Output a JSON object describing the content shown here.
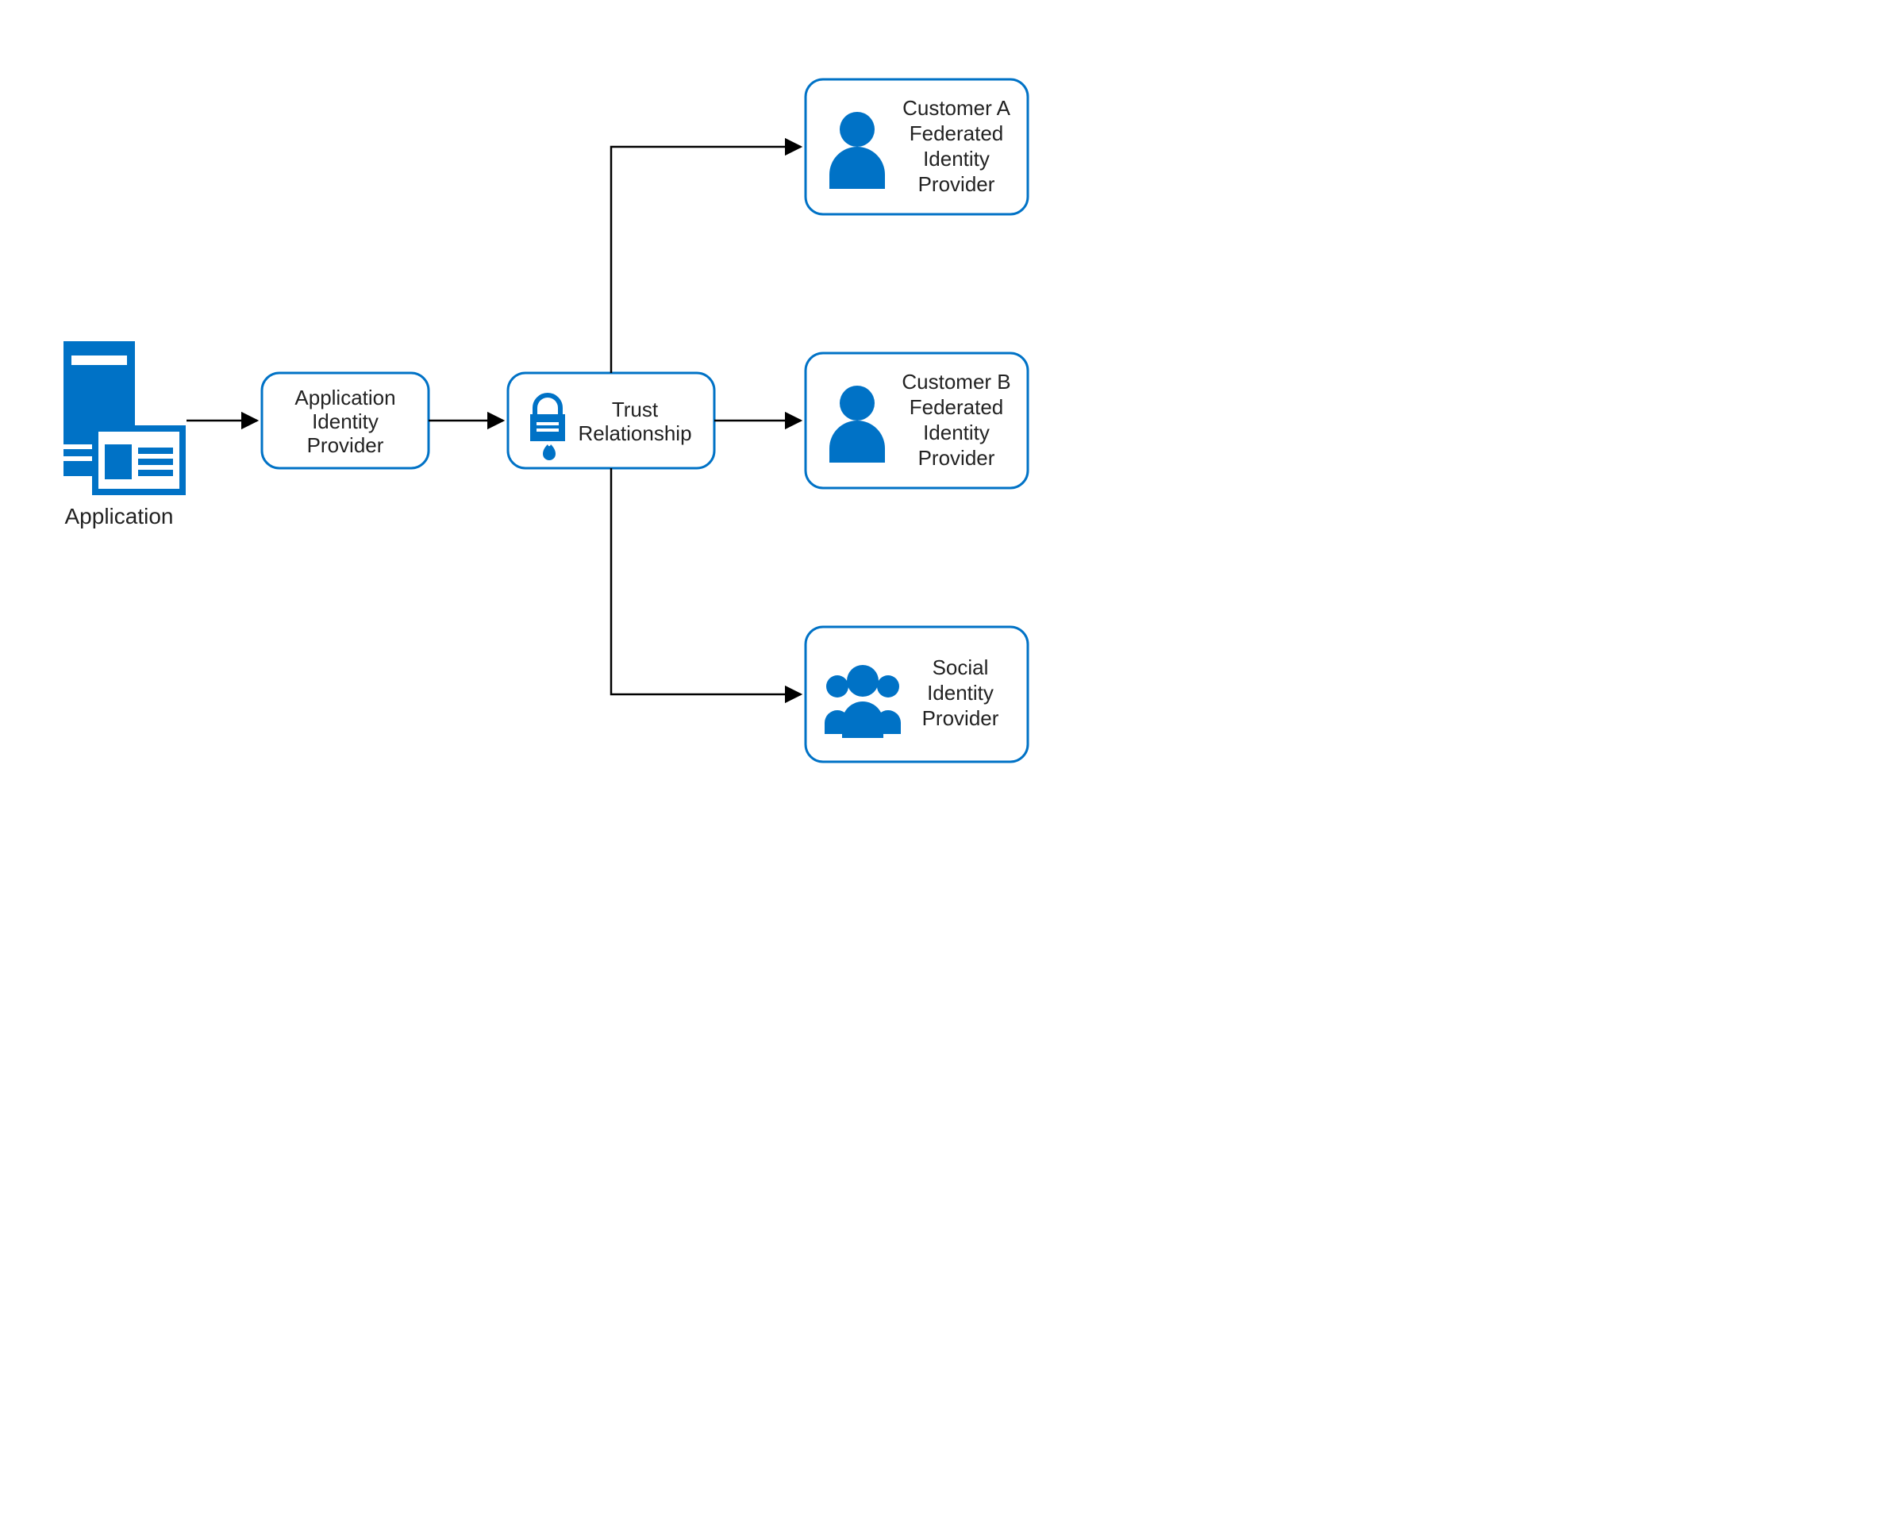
{
  "application": {
    "caption": "Application"
  },
  "nodes": {
    "app_idp": {
      "line1": "Application",
      "line2": "Identity",
      "line3": "Provider"
    },
    "trust": {
      "line1": "Trust",
      "line2": "Relationship"
    },
    "customer_a": {
      "line1": "Customer A",
      "line2": "Federated",
      "line3": "Identity",
      "line4": "Provider"
    },
    "customer_b": {
      "line1": "Customer B",
      "line2": "Federated",
      "line3": "Identity",
      "line4": "Provider"
    },
    "social": {
      "line1": "Social",
      "line2": "Identity",
      "line3": "Provider"
    }
  },
  "icons": {
    "application": "server-icon",
    "trust": "lock-icon",
    "customer_a": "person-icon",
    "customer_b": "person-icon",
    "social": "group-icon"
  },
  "colors": {
    "accent": "#0072C6",
    "text": "#222222"
  }
}
